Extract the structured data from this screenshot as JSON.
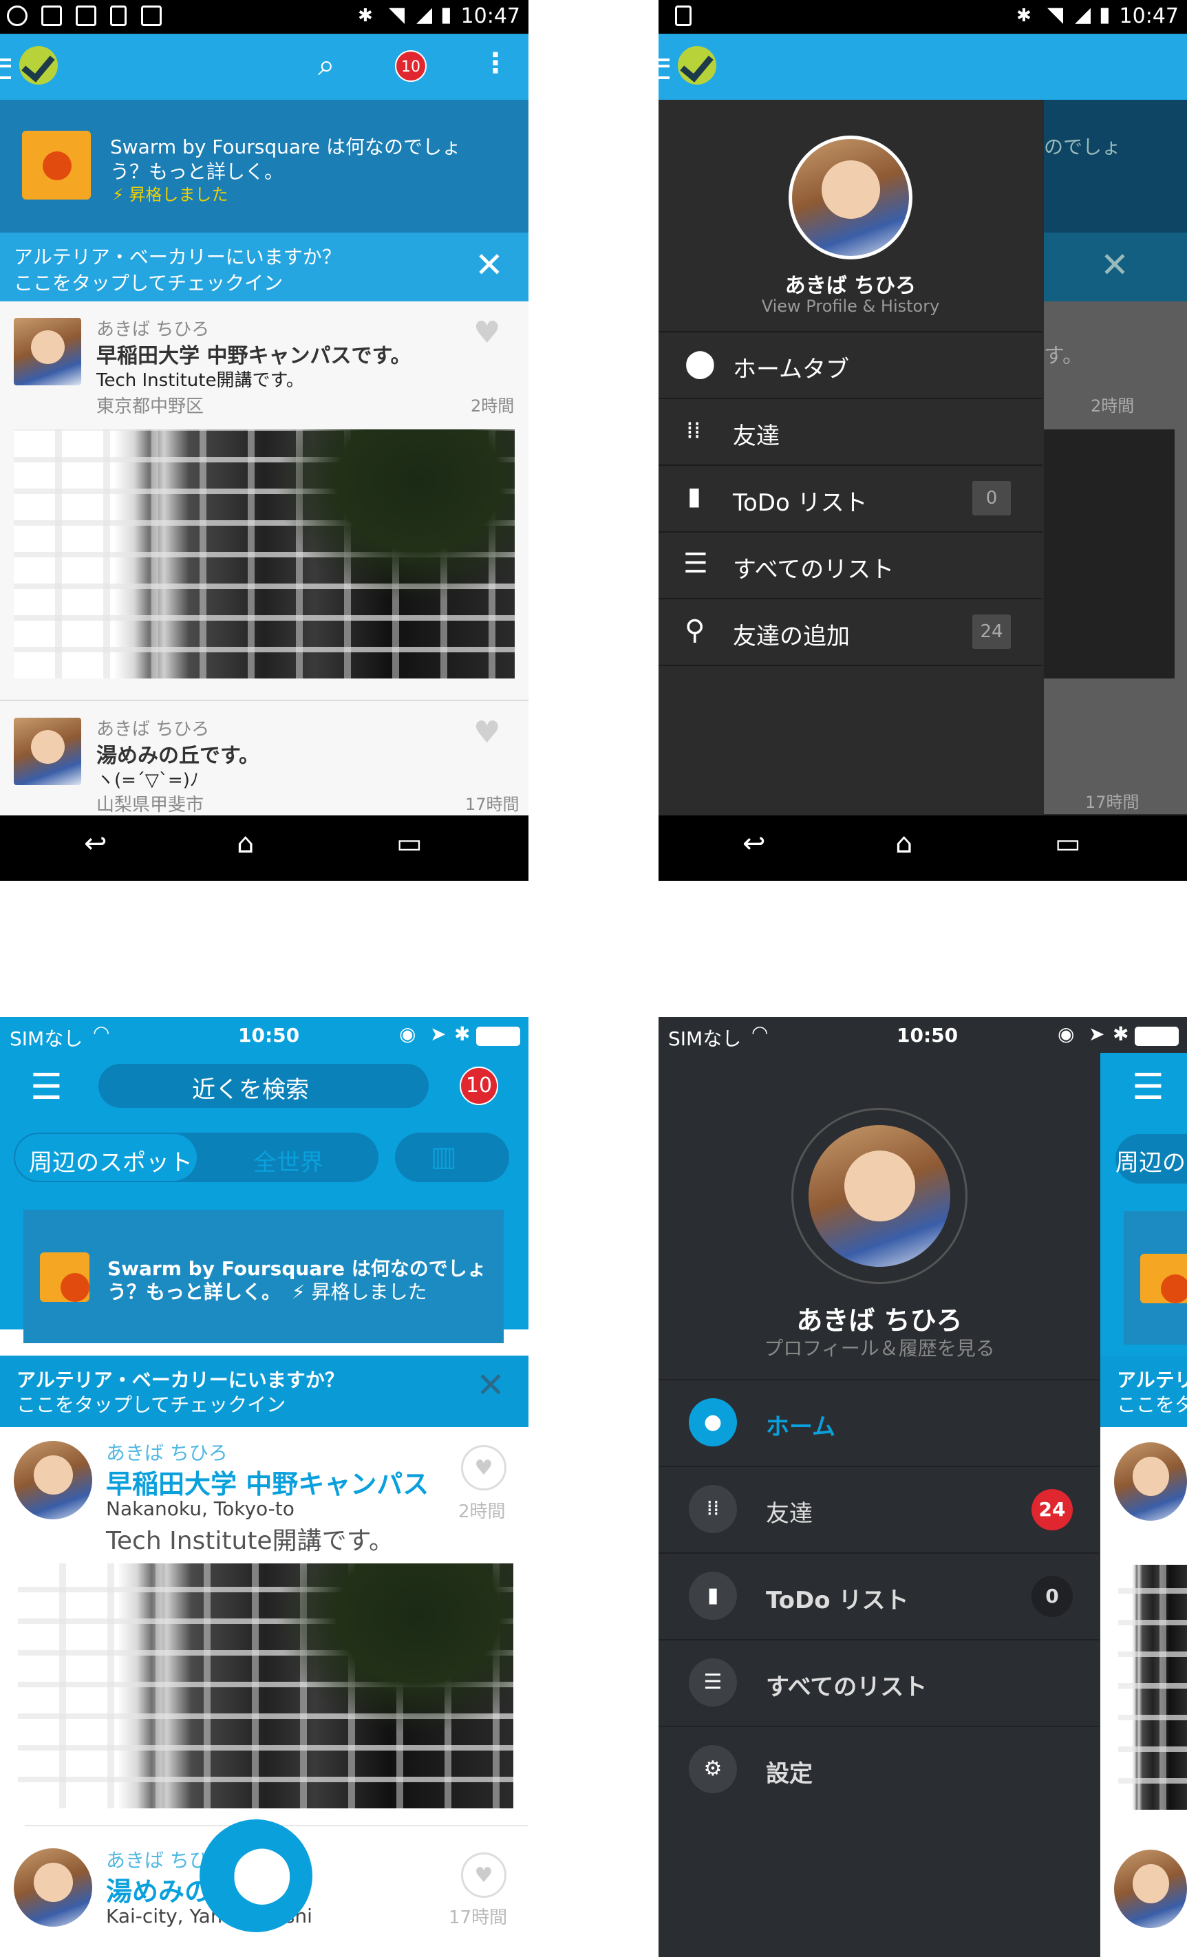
{
  "android_feed": {
    "status_time": "10:47",
    "notification_count": "10",
    "swarm_title": "Swarm by Foursquare は何なのでしょう？もっと詳しく。",
    "swarm_title_line1": "Swarm by Foursquare は何なのでしょ",
    "swarm_title_line2": "う？もっと詳しく。",
    "swarm_sub": "⚡ 昇格しました",
    "checkin_line1": "アルテリア・ベーカリーにいますか？",
    "checkin_line2": "ここをタップしてチェックイン",
    "items": [
      {
        "user": "あきば ちひろ",
        "place": "早稲田大学 中野キャンパスです。",
        "comment": "Tech Institute開講です。",
        "location": "東京都中野区",
        "time": "2時間"
      },
      {
        "user": "あきば ちひろ",
        "place": "湯めみの丘です。",
        "comment": "ヽ(=´▽`=)ﾉ",
        "location": "山梨県甲斐市",
        "time": "17時間"
      }
    ]
  },
  "android_drawer": {
    "status_time": "10:47",
    "name": "あきば ちひろ",
    "profile_link": "View Profile & History",
    "items": [
      {
        "label": "ホームタブ",
        "count": ""
      },
      {
        "label": "友達",
        "count": ""
      },
      {
        "label": "ToDo リスト",
        "count": "0"
      },
      {
        "label": "すべてのリスト",
        "count": ""
      },
      {
        "label": "友達の追加",
        "count": "24"
      }
    ],
    "bg_text_1": "のでしょ",
    "bg_text_2": "す。",
    "bg_time_1": "2時間",
    "bg_time_2": "17時間"
  },
  "ios_feed": {
    "carrier": "SIMなし",
    "status_time": "10:50",
    "search_placeholder": "近くを検索",
    "notification_count": "10",
    "tab_nearby": "周辺のスポット",
    "tab_world": "全世界",
    "swarm_line1": "Swarm by Foursquare は何なのでしょ",
    "swarm_line2": "う？もっと詳しく。",
    "swarm_sub": "⚡ 昇格しました",
    "checkin_line1": "アルテリア・ベーカリーにいますか？",
    "checkin_line2": "ここをタップしてチェックイン",
    "items": [
      {
        "user": "あきば ちひろ",
        "place": "早稲田大学 中野キャンパス",
        "location": "Nakanoku, Tokyo-to",
        "comment": "Tech Institute開講です。",
        "time": "2時間"
      },
      {
        "user": "あきば ちひ",
        "place": "湯めみの",
        "location": "Kai-city, Yama",
        "location_tail": "nshi",
        "time": "17時間"
      }
    ]
  },
  "ios_drawer": {
    "carrier": "SIMなし",
    "status_time": "10:50",
    "name": "あきば ちひろ",
    "profile_link": "プロフィール＆履歴を見る",
    "items": [
      {
        "label": "ホーム",
        "count": ""
      },
      {
        "label": "友達",
        "count": "24"
      },
      {
        "label": "ToDo リスト",
        "count": "0"
      },
      {
        "label": "すべてのリスト",
        "count": ""
      },
      {
        "label": "設定",
        "count": ""
      }
    ],
    "bg_tab": "周辺の",
    "bg_check_1": "アルテリ",
    "bg_check_2": "ここをタ"
  },
  "colors": {
    "accent": "#22a8e5",
    "ios_accent": "#0aa0dc",
    "badge": "#e0262e",
    "drawer_bg": "#2c2c2c"
  }
}
